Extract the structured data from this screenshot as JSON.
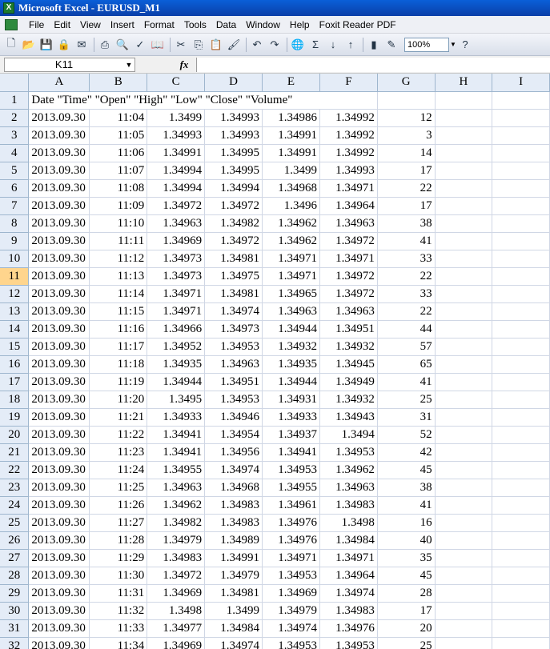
{
  "window": {
    "title": "Microsoft Excel - EURUSD_M1"
  },
  "menu": [
    "File",
    "Edit",
    "View",
    "Insert",
    "Format",
    "Tools",
    "Data",
    "Window",
    "Help",
    "Foxit Reader PDF"
  ],
  "toolbar": {
    "zoom": "100%"
  },
  "formula_bar": {
    "name_box": "K11",
    "fx_label": "fx",
    "content": ""
  },
  "columns": [
    "A",
    "B",
    "C",
    "D",
    "E",
    "F",
    "G",
    "H",
    "I"
  ],
  "active_row": 11,
  "header_row": {
    "row": 1,
    "text": "Date \"Time\" \"Open\" \"High\" \"Low\" \"Close\" \"Volume\""
  },
  "rows": [
    {
      "r": 2,
      "date": "2013.09.30",
      "time": "11:04",
      "open": "1.3499",
      "high": "1.34993",
      "low": "1.34986",
      "close": "1.34992",
      "volume": "12"
    },
    {
      "r": 3,
      "date": "2013.09.30",
      "time": "11:05",
      "open": "1.34993",
      "high": "1.34993",
      "low": "1.34991",
      "close": "1.34992",
      "volume": "3"
    },
    {
      "r": 4,
      "date": "2013.09.30",
      "time": "11:06",
      "open": "1.34991",
      "high": "1.34995",
      "low": "1.34991",
      "close": "1.34992",
      "volume": "14"
    },
    {
      "r": 5,
      "date": "2013.09.30",
      "time": "11:07",
      "open": "1.34994",
      "high": "1.34995",
      "low": "1.3499",
      "close": "1.34993",
      "volume": "17"
    },
    {
      "r": 6,
      "date": "2013.09.30",
      "time": "11:08",
      "open": "1.34994",
      "high": "1.34994",
      "low": "1.34968",
      "close": "1.34971",
      "volume": "22"
    },
    {
      "r": 7,
      "date": "2013.09.30",
      "time": "11:09",
      "open": "1.34972",
      "high": "1.34972",
      "low": "1.3496",
      "close": "1.34964",
      "volume": "17"
    },
    {
      "r": 8,
      "date": "2013.09.30",
      "time": "11:10",
      "open": "1.34963",
      "high": "1.34982",
      "low": "1.34962",
      "close": "1.34963",
      "volume": "38"
    },
    {
      "r": 9,
      "date": "2013.09.30",
      "time": "11:11",
      "open": "1.34969",
      "high": "1.34972",
      "low": "1.34962",
      "close": "1.34972",
      "volume": "41"
    },
    {
      "r": 10,
      "date": "2013.09.30",
      "time": "11:12",
      "open": "1.34973",
      "high": "1.34981",
      "low": "1.34971",
      "close": "1.34971",
      "volume": "33"
    },
    {
      "r": 11,
      "date": "2013.09.30",
      "time": "11:13",
      "open": "1.34973",
      "high": "1.34975",
      "low": "1.34971",
      "close": "1.34972",
      "volume": "22"
    },
    {
      "r": 12,
      "date": "2013.09.30",
      "time": "11:14",
      "open": "1.34971",
      "high": "1.34981",
      "low": "1.34965",
      "close": "1.34972",
      "volume": "33"
    },
    {
      "r": 13,
      "date": "2013.09.30",
      "time": "11:15",
      "open": "1.34971",
      "high": "1.34974",
      "low": "1.34963",
      "close": "1.34963",
      "volume": "22"
    },
    {
      "r": 14,
      "date": "2013.09.30",
      "time": "11:16",
      "open": "1.34966",
      "high": "1.34973",
      "low": "1.34944",
      "close": "1.34951",
      "volume": "44"
    },
    {
      "r": 15,
      "date": "2013.09.30",
      "time": "11:17",
      "open": "1.34952",
      "high": "1.34953",
      "low": "1.34932",
      "close": "1.34932",
      "volume": "57"
    },
    {
      "r": 16,
      "date": "2013.09.30",
      "time": "11:18",
      "open": "1.34935",
      "high": "1.34963",
      "low": "1.34935",
      "close": "1.34945",
      "volume": "65"
    },
    {
      "r": 17,
      "date": "2013.09.30",
      "time": "11:19",
      "open": "1.34944",
      "high": "1.34951",
      "low": "1.34944",
      "close": "1.34949",
      "volume": "41"
    },
    {
      "r": 18,
      "date": "2013.09.30",
      "time": "11:20",
      "open": "1.3495",
      "high": "1.34953",
      "low": "1.34931",
      "close": "1.34932",
      "volume": "25"
    },
    {
      "r": 19,
      "date": "2013.09.30",
      "time": "11:21",
      "open": "1.34933",
      "high": "1.34946",
      "low": "1.34933",
      "close": "1.34943",
      "volume": "31"
    },
    {
      "r": 20,
      "date": "2013.09.30",
      "time": "11:22",
      "open": "1.34941",
      "high": "1.34954",
      "low": "1.34937",
      "close": "1.3494",
      "volume": "52"
    },
    {
      "r": 21,
      "date": "2013.09.30",
      "time": "11:23",
      "open": "1.34941",
      "high": "1.34956",
      "low": "1.34941",
      "close": "1.34953",
      "volume": "42"
    },
    {
      "r": 22,
      "date": "2013.09.30",
      "time": "11:24",
      "open": "1.34955",
      "high": "1.34974",
      "low": "1.34953",
      "close": "1.34962",
      "volume": "45"
    },
    {
      "r": 23,
      "date": "2013.09.30",
      "time": "11:25",
      "open": "1.34963",
      "high": "1.34968",
      "low": "1.34955",
      "close": "1.34963",
      "volume": "38"
    },
    {
      "r": 24,
      "date": "2013.09.30",
      "time": "11:26",
      "open": "1.34962",
      "high": "1.34983",
      "low": "1.34961",
      "close": "1.34983",
      "volume": "41"
    },
    {
      "r": 25,
      "date": "2013.09.30",
      "time": "11:27",
      "open": "1.34982",
      "high": "1.34983",
      "low": "1.34976",
      "close": "1.3498",
      "volume": "16"
    },
    {
      "r": 26,
      "date": "2013.09.30",
      "time": "11:28",
      "open": "1.34979",
      "high": "1.34989",
      "low": "1.34976",
      "close": "1.34984",
      "volume": "40"
    },
    {
      "r": 27,
      "date": "2013.09.30",
      "time": "11:29",
      "open": "1.34983",
      "high": "1.34991",
      "low": "1.34971",
      "close": "1.34971",
      "volume": "35"
    },
    {
      "r": 28,
      "date": "2013.09.30",
      "time": "11:30",
      "open": "1.34972",
      "high": "1.34979",
      "low": "1.34953",
      "close": "1.34964",
      "volume": "45"
    },
    {
      "r": 29,
      "date": "2013.09.30",
      "time": "11:31",
      "open": "1.34969",
      "high": "1.34981",
      "low": "1.34969",
      "close": "1.34974",
      "volume": "28"
    },
    {
      "r": 30,
      "date": "2013.09.30",
      "time": "11:32",
      "open": "1.3498",
      "high": "1.3499",
      "low": "1.34979",
      "close": "1.34983",
      "volume": "17"
    },
    {
      "r": 31,
      "date": "2013.09.30",
      "time": "11:33",
      "open": "1.34977",
      "high": "1.34984",
      "low": "1.34974",
      "close": "1.34976",
      "volume": "20"
    },
    {
      "r": 32,
      "date": "2013.09.30",
      "time": "11:34",
      "open": "1.34969",
      "high": "1.34974",
      "low": "1.34953",
      "close": "1.34953",
      "volume": "25"
    }
  ]
}
